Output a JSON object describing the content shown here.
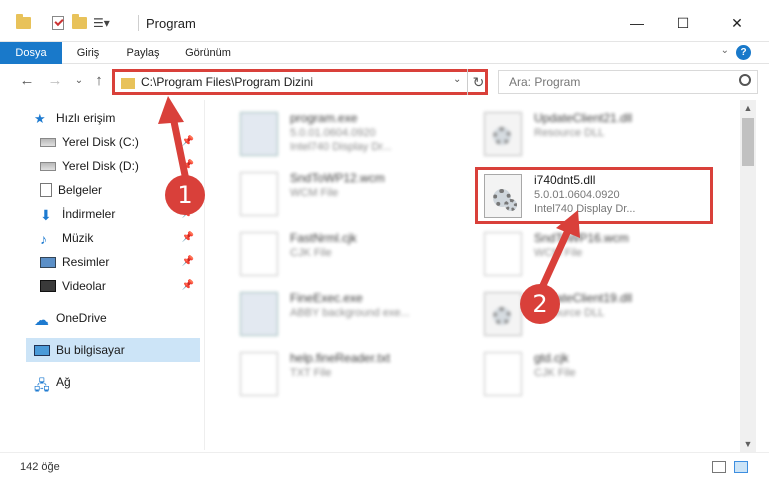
{
  "window": {
    "title": "Program",
    "minimize": "—",
    "maximize": "☐",
    "close": "✕"
  },
  "ribbon": {
    "tabs": [
      "Dosya",
      "Giriş",
      "Paylaş",
      "Görünüm"
    ],
    "expand": "⌄",
    "help": "?"
  },
  "nav": {
    "back": "←",
    "forward": "→",
    "recent": "⌄",
    "up": "↑",
    "path": "C:\\Program Files\\Program Dizini",
    "dropdown": "⌄",
    "refresh": "↻",
    "search_placeholder": "Ara: Program"
  },
  "sidebar": {
    "items": [
      {
        "label": "Hızlı erişim",
        "icon": "star-icon"
      },
      {
        "label": "Yerel Disk (C:)",
        "icon": "disk-icon",
        "pinned": true
      },
      {
        "label": "Yerel Disk (D:)",
        "icon": "disk-icon",
        "pinned": true
      },
      {
        "label": "Belgeler",
        "icon": "document-icon",
        "pinned": true
      },
      {
        "label": "İndirmeler",
        "icon": "download-icon",
        "pinned": true
      },
      {
        "label": "Müzik",
        "icon": "music-icon",
        "pinned": true
      },
      {
        "label": "Resimler",
        "icon": "pictures-icon",
        "pinned": true
      },
      {
        "label": "Videolar",
        "icon": "videos-icon",
        "pinned": true
      },
      {
        "label": "OneDrive",
        "icon": "cloud-icon"
      },
      {
        "label": "Bu bilgisayar",
        "icon": "computer-icon",
        "selected": true
      },
      {
        "label": "Ağ",
        "icon": "network-icon"
      }
    ]
  },
  "files": [
    {
      "name": "program.exe",
      "line1": "5.0.01.0604.0920",
      "line2": "Intel740 Display Dr...",
      "icon": "exe-icon"
    },
    {
      "name": "UpdateClient21.dll",
      "line1": "Resource DLL",
      "line2": "",
      "icon": "dll-icon"
    },
    {
      "name": "SndToWP12.wcm",
      "line1": "WCM File",
      "line2": "",
      "icon": "file-icon"
    },
    {
      "name": "i740dnt5.dll",
      "line1": "5.0.01.0604.0920",
      "line2": "Intel740 Display Dr...",
      "icon": "dll-icon",
      "highlighted": true
    },
    {
      "name": "FastNrml.cjk",
      "line1": "CJK File",
      "line2": "",
      "icon": "file-icon"
    },
    {
      "name": "SndToWP16.wcm",
      "line1": "WCM File",
      "line2": "",
      "icon": "file-icon"
    },
    {
      "name": "FineExec.exe",
      "line1": "ABBY background exe...",
      "line2": "",
      "icon": "exe-icon"
    },
    {
      "name": "UpdateClient19.dll",
      "line1": "Resource DLL",
      "line2": "",
      "icon": "dll-icon"
    },
    {
      "name": "help.fineReader.txt",
      "line1": "TXT File",
      "line2": "",
      "icon": "file-icon"
    },
    {
      "name": "gtd.cjk",
      "line1": "CJK File",
      "line2": "",
      "icon": "file-icon"
    }
  ],
  "status": {
    "count": "142 öğe"
  },
  "callouts": [
    "1",
    "2"
  ],
  "colors": {
    "accent": "#1979ca",
    "highlight": "#d9403a",
    "selection": "#cce4f7"
  }
}
